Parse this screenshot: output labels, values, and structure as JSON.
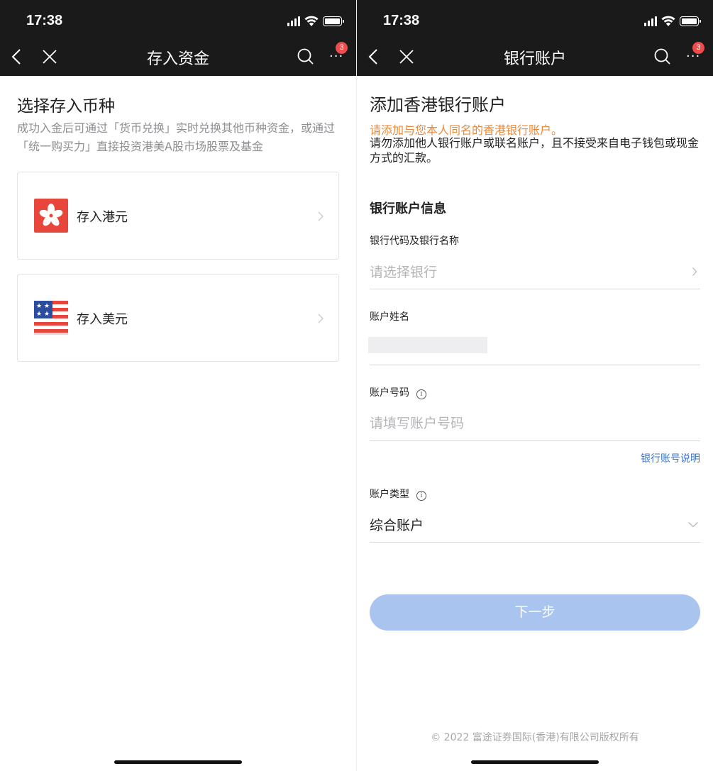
{
  "left_screen": {
    "status": {
      "time": "17:38"
    },
    "nav": {
      "title": "存入资金",
      "badge_count": "3",
      "more_glyph": "···"
    },
    "heading": "选择存入币种",
    "description": "成功入金后可通过「货币兑换」实时兑换其他币种资金，或通过「统一购买力」直接投资港美A股市场股票及基金",
    "options": [
      {
        "label": "存入港元",
        "icon": "hong-kong-flag-icon"
      },
      {
        "label": "存入美元",
        "icon": "us-flag-icon"
      }
    ]
  },
  "right_screen": {
    "status": {
      "time": "17:38"
    },
    "nav": {
      "title": "银行账户",
      "badge_count": "3",
      "more_glyph": "···"
    },
    "heading": "添加香港银行账户",
    "warning": "请添加与您本人同名的香港银行账户。",
    "note": "请勿添加他人银行账户或联名账户，且不接受来自电子钱包或现金方式的汇款。",
    "section_title": "银行账户信息",
    "fields": {
      "bank": {
        "label": "银行代码及银行名称",
        "placeholder": "请选择银行"
      },
      "account_name": {
        "label": "账户姓名",
        "value": ""
      },
      "account_number": {
        "label": "账户号码",
        "placeholder": "请填写账户号码"
      },
      "account_type": {
        "label": "账户类型",
        "value": "综合账户"
      }
    },
    "help_link": "银行账号说明",
    "next_button": "下一步",
    "copyright": "© 2022 富途证券国际(香港)有限公司版权所有"
  },
  "colors": {
    "topbar": "#1a1a1a",
    "badge": "#f04b4b",
    "warning_text": "#e88a3c",
    "link": "#3d72c9",
    "button_disabled": "#a9c4ef"
  }
}
